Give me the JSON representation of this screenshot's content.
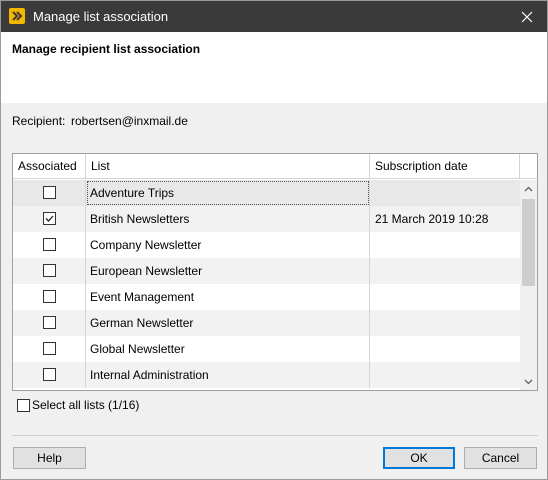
{
  "window": {
    "title": "Manage list association",
    "app_icon": "inxmail-logo-icon",
    "close_icon": "close-icon"
  },
  "header": {
    "heading": "Manage recipient list association"
  },
  "recipient": {
    "label": "Recipient:",
    "value": "robertsen@inxmail.de"
  },
  "table": {
    "columns": [
      "Associated",
      "List",
      "Subscription date"
    ],
    "rows": [
      {
        "associated": false,
        "list": "Adventure Trips",
        "date": "",
        "selected": true
      },
      {
        "associated": true,
        "list": "British Newsletters",
        "date": "21 March 2019 10:28",
        "selected": false
      },
      {
        "associated": false,
        "list": "Company Newsletter",
        "date": "",
        "selected": false
      },
      {
        "associated": false,
        "list": "European Newsletter",
        "date": "",
        "selected": false
      },
      {
        "associated": false,
        "list": "Event Management",
        "date": "",
        "selected": false
      },
      {
        "associated": false,
        "list": "German Newsletter",
        "date": "",
        "selected": false
      },
      {
        "associated": false,
        "list": "Global Newsletter",
        "date": "",
        "selected": false
      },
      {
        "associated": false,
        "list": "Internal Administration",
        "date": "",
        "selected": false
      }
    ]
  },
  "select_all": {
    "label": "Select all lists (1/16)",
    "checked": false
  },
  "buttons": {
    "help": "Help",
    "ok": "OK",
    "cancel": "Cancel"
  },
  "colors": {
    "titlebar": "#3a3a3a",
    "app_icon": "#f5b800",
    "default_button_border": "#0078d7"
  }
}
